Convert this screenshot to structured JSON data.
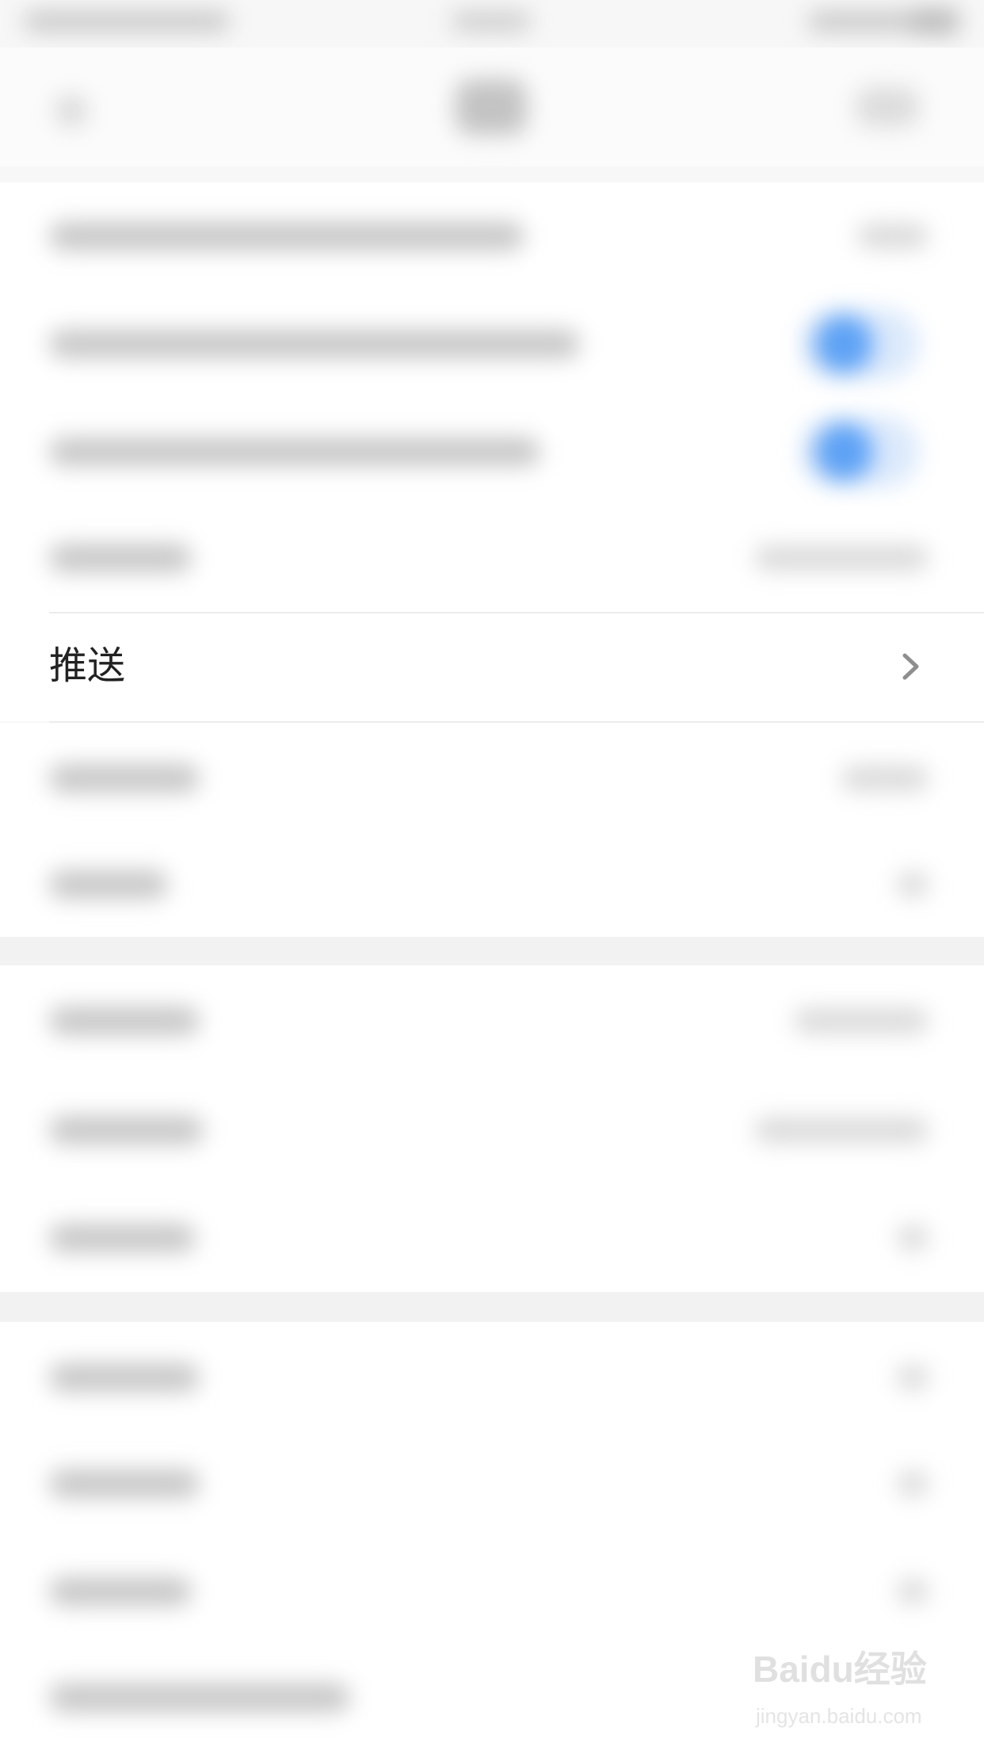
{
  "push_item": {
    "label": "推送",
    "chevron_icon": "chevron-right-icon"
  },
  "colors": {
    "toggle_on": "#5ea2f5",
    "chevron": "#8e8e8e",
    "label_text": "#222222"
  },
  "watermark": {
    "logo": "Baidu经验",
    "url": "jingyan.baidu.com"
  }
}
